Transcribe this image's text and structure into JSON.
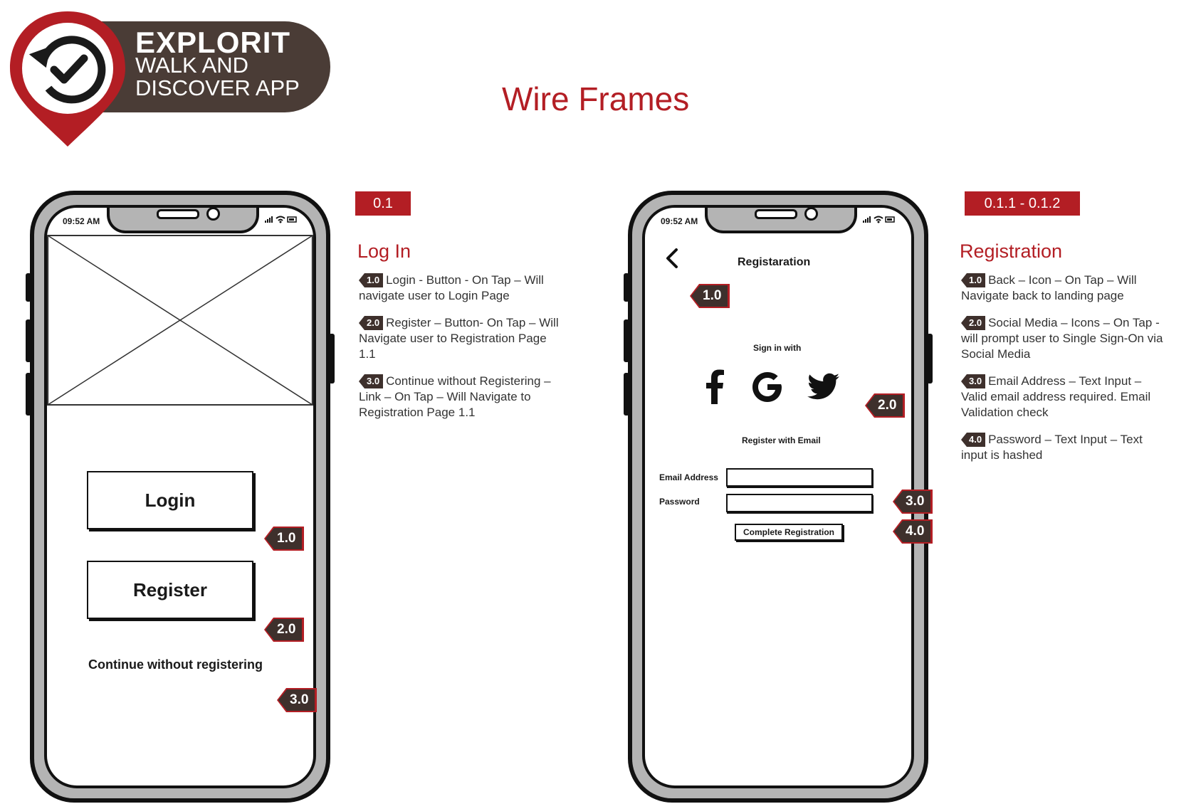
{
  "logo": {
    "line1": "EXPLORIT",
    "line2": "WALK AND",
    "line3": "DISCOVER APP"
  },
  "page_title": "Wire Frames",
  "colors": {
    "accent": "#b31e24",
    "tag_dark": "#3e302c",
    "logo_dark": "#4a3c36",
    "phone_frame": "#b4b4b4"
  },
  "login_phone": {
    "status_time": "09:52 AM",
    "status_icons": "signal-icon wifi-icon battery-icon",
    "login_label": "Login",
    "register_label": "Register",
    "continue_label": "Continue without registering",
    "tags": [
      "1.0",
      "2.0",
      "3.0"
    ]
  },
  "login_notes": {
    "badge": "0.1",
    "title": "Log In",
    "items": [
      {
        "tag": "1.0",
        "text": "Login - Button - On Tap – Will navigate user to Login Page"
      },
      {
        "tag": "2.0",
        "text": "Register – Button- On Tap – Will Navigate user to Registration Page 1.1"
      },
      {
        "tag": "3.0",
        "text": "Continue without Registering – Link – On Tap – Will Navigate to Registration Page 1.1"
      }
    ]
  },
  "reg_phone": {
    "status_time": "09:52 AM",
    "back_icon": "chevron-left-icon",
    "title": "Registaration",
    "sign_in_with": "Sign in with",
    "social_icons": [
      "facebook-icon",
      "google-icon",
      "twitter-icon"
    ],
    "register_email": "Register with Email",
    "email_label": "Email Address",
    "password_label": "Password",
    "complete_label": "Complete Registration",
    "tags": [
      "1.0",
      "2.0",
      "3.0",
      "4.0"
    ]
  },
  "reg_notes": {
    "badge": "0.1.1 - 0.1.2",
    "title": "Registration",
    "items": [
      {
        "tag": "1.0",
        "text": "Back – Icon – On Tap – Will Navigate back to landing page"
      },
      {
        "tag": "2.0",
        "text": "Social Media – Icons – On Tap - will prompt user to Single Sign-On via Social Media"
      },
      {
        "tag": "3.0",
        "text": "Email Address – Text Input – Valid email address required. Email Validation check"
      },
      {
        "tag": "4.0",
        "text": "Password – Text Input – Text input is hashed"
      }
    ]
  }
}
